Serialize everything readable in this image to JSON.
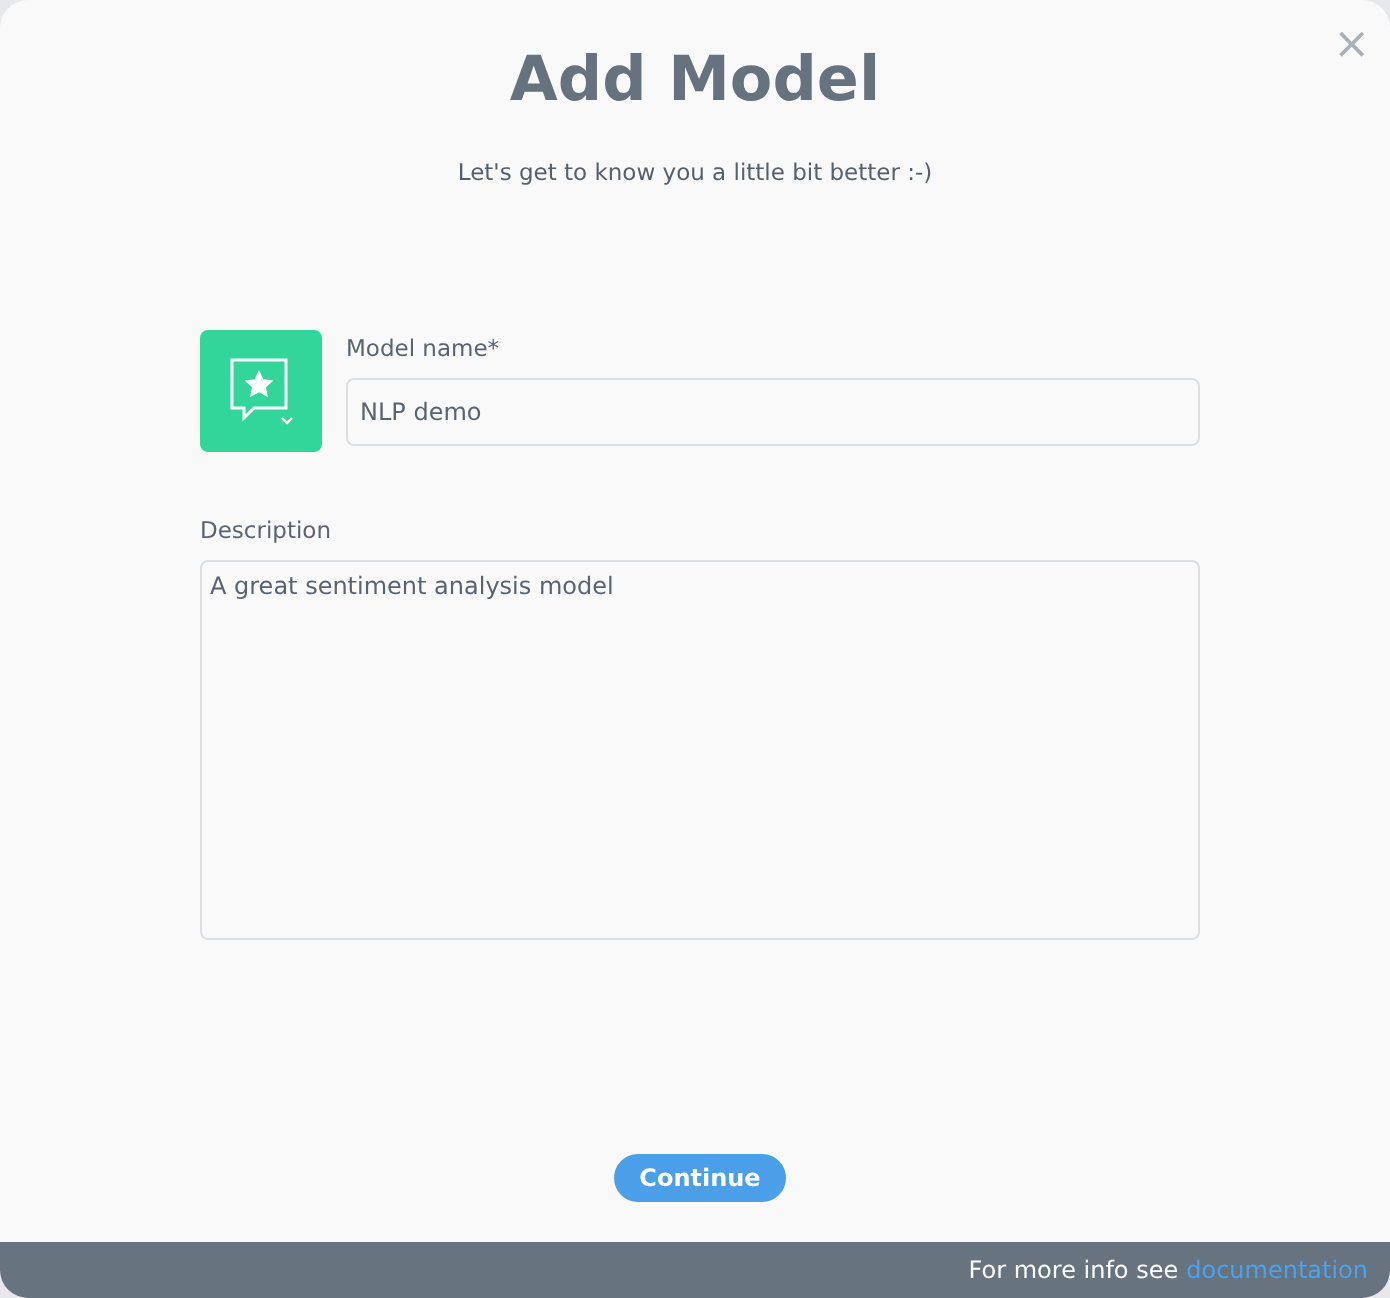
{
  "dialog": {
    "title": "Add Model",
    "subtitle": "Let's get to know you a little bit better :-)",
    "close": "×"
  },
  "form": {
    "name_label": "Model name*",
    "name_value": "NLP demo",
    "description_label": "Description",
    "description_value": "A great sentiment analysis model"
  },
  "button": "Continue",
  "footer": {
    "text": "For more info see",
    "link": "documentation"
  }
}
